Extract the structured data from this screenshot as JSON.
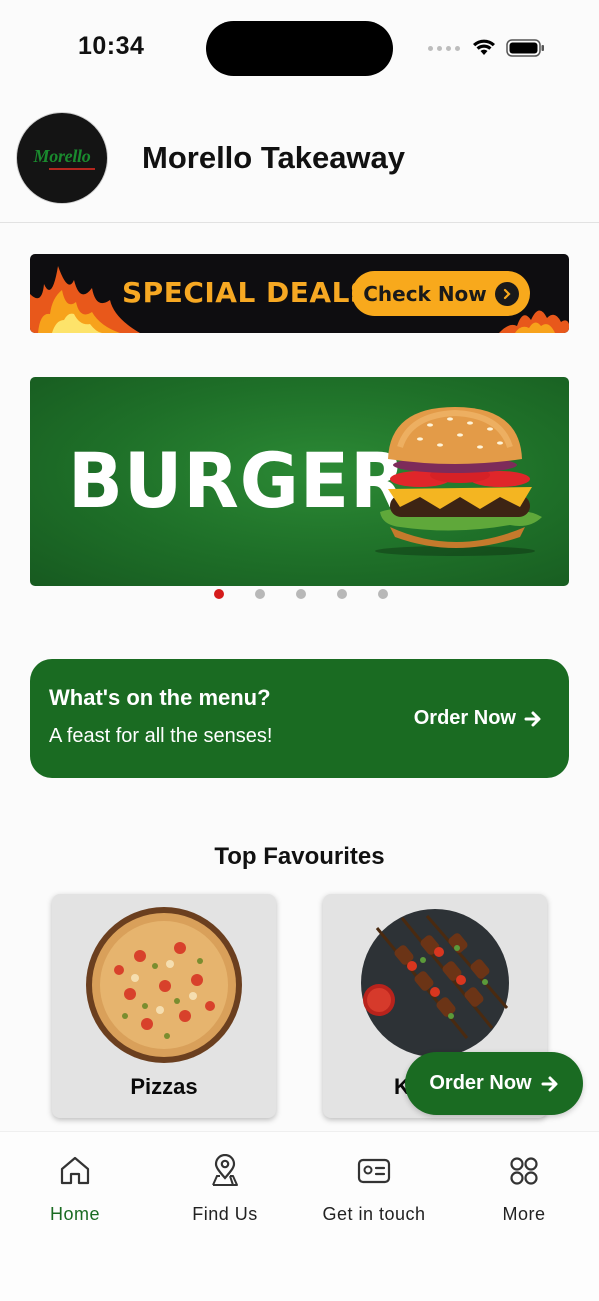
{
  "status_bar": {
    "time": "10:34"
  },
  "header": {
    "title": "Morello Takeaway",
    "logo_text": "Morello"
  },
  "deals_banner": {
    "text": "SPECIAL DEALS",
    "button_label": "Check Now"
  },
  "carousel": {
    "title": "BURGER",
    "slide_count": 5,
    "active_index": 0
  },
  "menu_card": {
    "title": "What's on the menu?",
    "subtitle": "A feast for all the senses!",
    "action_label": "Order Now"
  },
  "favourites": {
    "title": "Top Favourites",
    "items": [
      {
        "label": "Pizzas"
      },
      {
        "label": "K"
      }
    ]
  },
  "floating_button": {
    "label": "Order Now"
  },
  "tab_bar": {
    "items": [
      {
        "label": "Home",
        "icon": "home-icon",
        "active": true
      },
      {
        "label": "Find Us",
        "icon": "location-icon",
        "active": false
      },
      {
        "label": "Get in touch",
        "icon": "contact-card-icon",
        "active": false
      },
      {
        "label": "More",
        "icon": "grid-icon",
        "active": false
      }
    ]
  },
  "colors": {
    "brand_green": "#1a6b22",
    "deal_orange": "#f8a91c",
    "active_dot": "#d51b1b"
  }
}
